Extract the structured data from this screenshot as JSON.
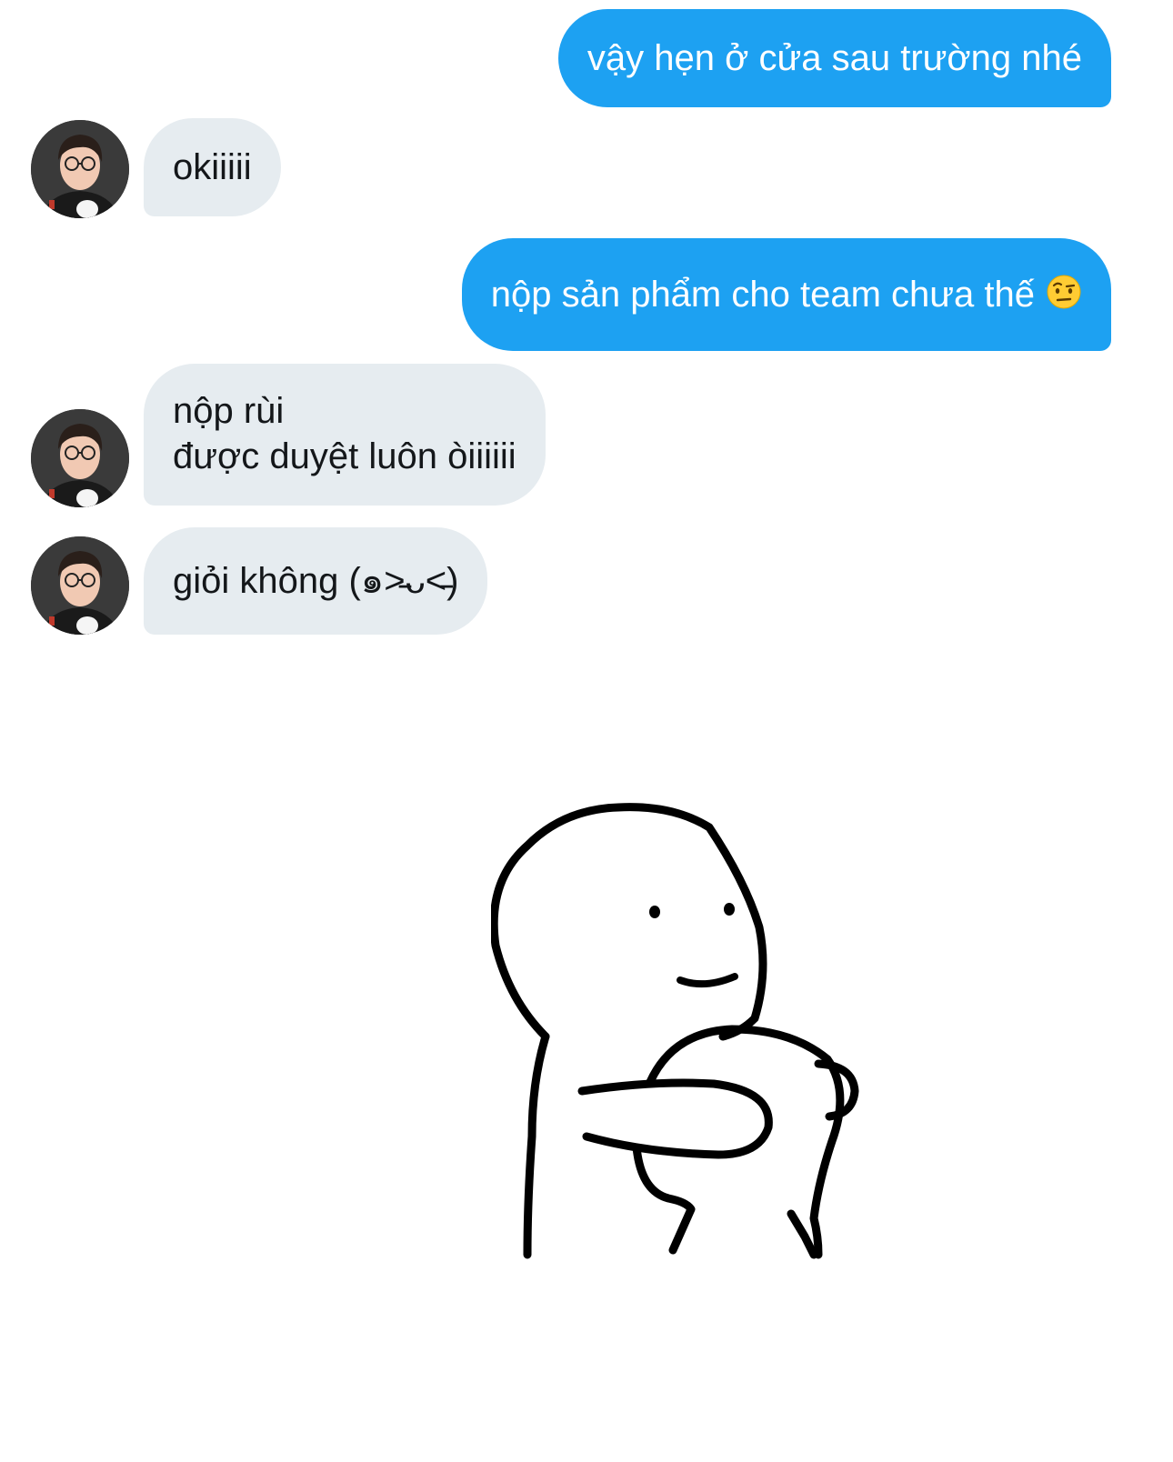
{
  "conversation": {
    "messages": [
      {
        "from": "me",
        "lines": [
          "vậy hẹn ở cửa sau trường nhé"
        ]
      },
      {
        "from": "them",
        "lines": [
          "okiiiii"
        ]
      },
      {
        "from": "me",
        "lines": [
          "nộp sản phẩm cho team chưa thế"
        ],
        "emoji": "face-with-raised-eyebrow-icon"
      },
      {
        "from": "them",
        "lines": [
          "nộp rùi",
          "được duyệt luôn òiiiiii"
        ]
      },
      {
        "from": "them",
        "lines": [
          "giỏi không (๑˃̵ᴗ˂̵)"
        ]
      }
    ],
    "sticker": "hugging-doodle-character"
  },
  "colors": {
    "sent_bubble": "#1da1f2",
    "received_bubble": "#e6ecf0",
    "sent_text": "#ffffff",
    "received_text": "#14171a"
  }
}
